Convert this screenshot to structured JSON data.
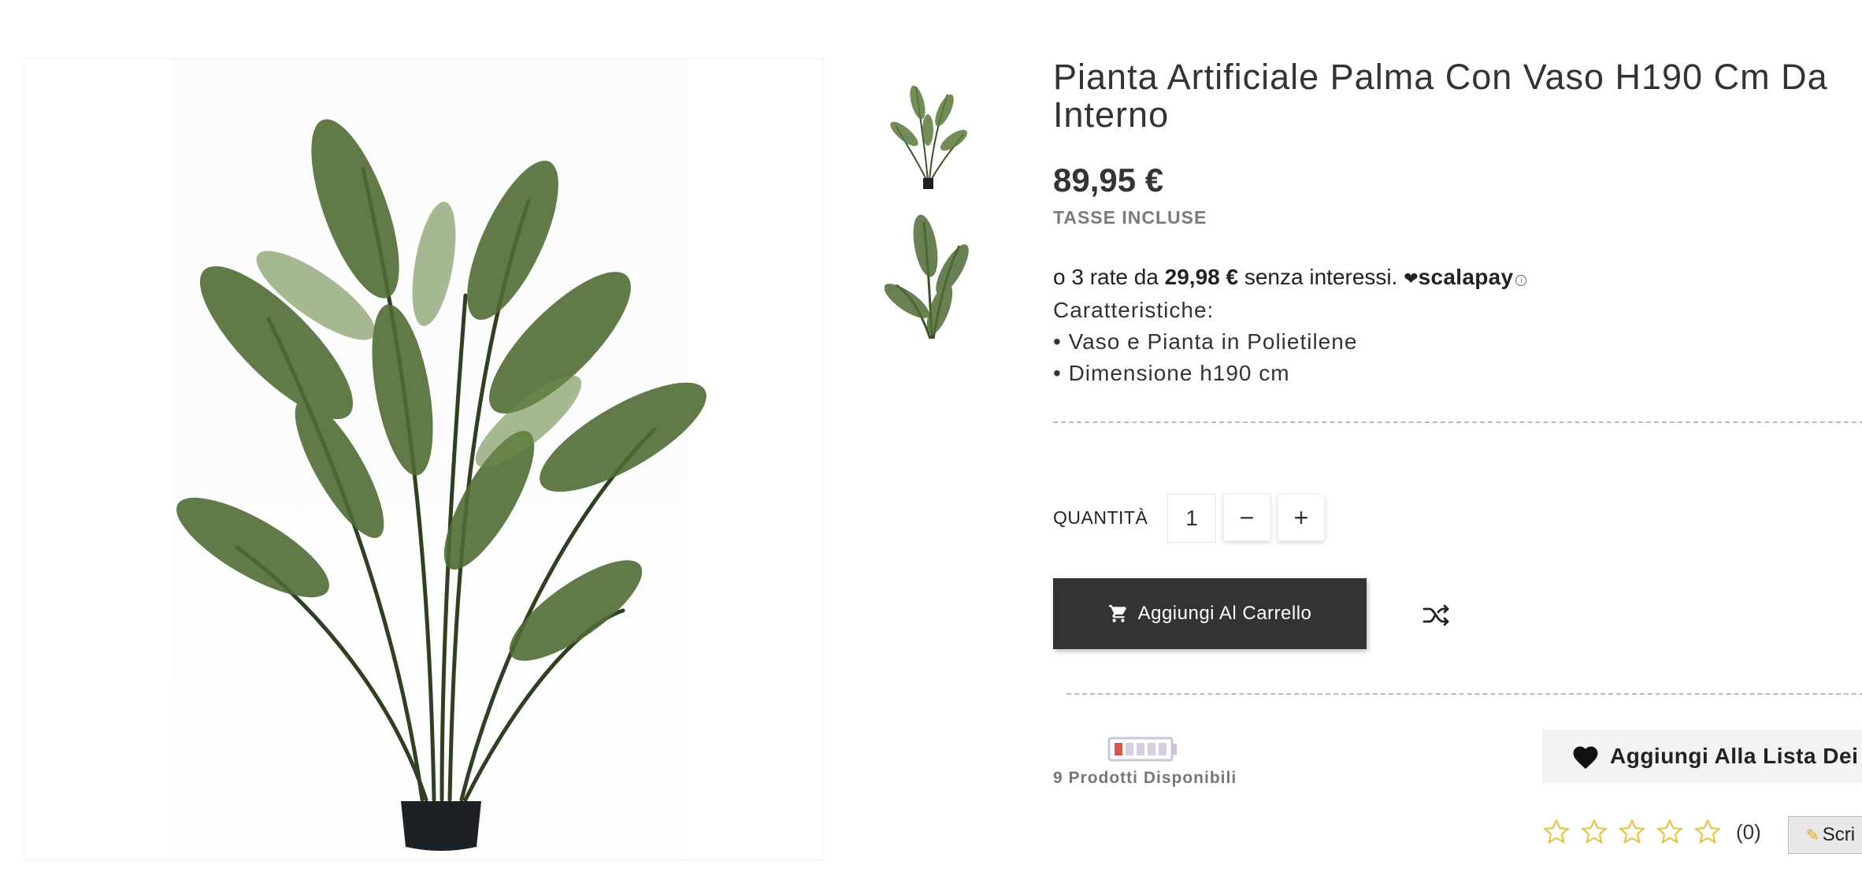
{
  "product": {
    "title": "Pianta Artificiale Palma Con Vaso H190 Cm Da Interno",
    "price": "89,95 €",
    "tax_label": "TASSE INCLUSE"
  },
  "scalapay": {
    "prefix": "o 3 rate da ",
    "installment": "29,98 €",
    "suffix": " senza interessi.",
    "brand": "scalapay"
  },
  "features": {
    "heading": "Caratteristiche:",
    "items": [
      "• Vaso e Pianta in Polietilene",
      "• Dimensione h190 cm"
    ]
  },
  "quantity": {
    "label": "QUANTITÀ",
    "value": "1",
    "minus": "−",
    "plus": "+"
  },
  "cart": {
    "add_label": "Aggiungi Al Carrello"
  },
  "stock": {
    "text": "9 Prodotti Disponibili",
    "level": 0.2
  },
  "wishlist": {
    "label": "Aggiungi Alla Lista Dei"
  },
  "reviews": {
    "rating": 0,
    "max": 5,
    "count": "(0)",
    "write_label": "Scri"
  },
  "icons": {
    "expand": "expand-icon",
    "cart": "cart-icon",
    "compare": "shuffle-icon",
    "wishlist": "heart-icon",
    "star": "star-outline-icon",
    "pencil": "pencil-icon"
  },
  "colors": {
    "primary_button": "#333333",
    "star": "#e6c64a",
    "stock_low": "#d9534f",
    "text": "#333333",
    "muted": "#7a7a7a"
  }
}
